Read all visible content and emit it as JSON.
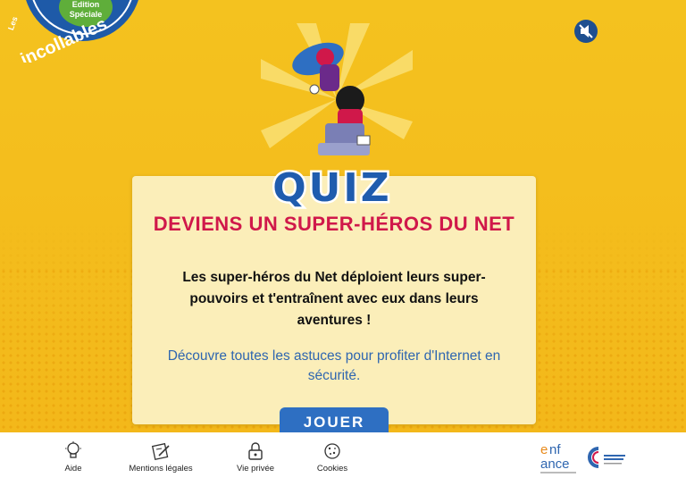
{
  "logo": {
    "brand": "Les incollables",
    "badge": "Edition Spéciale"
  },
  "card": {
    "quiz_label": "QUIZ",
    "title": "DEVIENS UN SUPER-HÉROS DU NET",
    "description": "Les super-héros du Net déploient leurs super-pouvoirs et t'entraînent avec eux dans leurs aventures !",
    "tip": "Découvre toutes les astuces pour profiter d'Internet en sécurité.",
    "play_label": "JOUER"
  },
  "footer": {
    "links": [
      {
        "label": "Aide",
        "icon": "lightbulb-icon"
      },
      {
        "label": "Mentions légales",
        "icon": "document-pen-icon"
      },
      {
        "label": "Vie privée",
        "icon": "padlock-icon"
      },
      {
        "label": "Cookies",
        "icon": "cookie-icon"
      }
    ],
    "partners": [
      "enfance",
      "cybermalveillance"
    ]
  },
  "colors": {
    "background": "#f4c21f",
    "title": "#d0184a",
    "button": "#2e6fc2",
    "link": "#2f66b0"
  }
}
